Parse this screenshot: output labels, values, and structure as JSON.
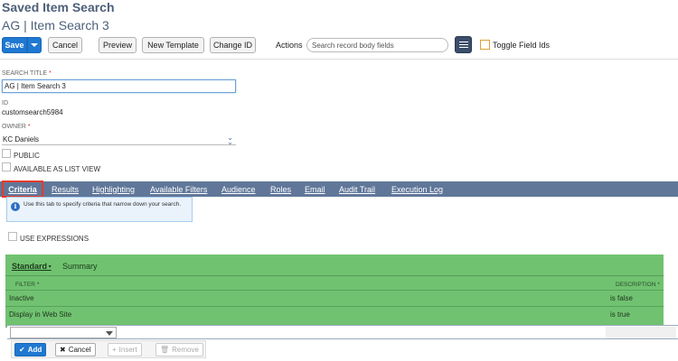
{
  "page": {
    "heading": "Saved Item Search",
    "record_title": "AG | Item Search 3"
  },
  "toolbar": {
    "save_label": "Save",
    "cancel_label": "Cancel",
    "preview_label": "Preview",
    "new_template_label": "New Template",
    "change_id_label": "Change ID",
    "actions_label": "Actions",
    "search_placeholder": "Search record body fields",
    "toggle_field_ids_label": "Toggle Field Ids",
    "primary_color": "#1f78d1",
    "toggle_color": "#e0a034"
  },
  "form": {
    "search_title_label": "SEARCH TITLE",
    "search_title_value": "AG | Item Search 3",
    "required_mark": "*",
    "id_label": "ID",
    "id_value": "customsearch5984",
    "owner_label": "OWNER",
    "owner_value": "KC Daniels",
    "public_label": "PUBLIC",
    "available_list_view_label": "AVAILABLE AS LIST VIEW"
  },
  "tabs": {
    "items": [
      {
        "label": "Criteria",
        "selected": true
      },
      {
        "label": "Results"
      },
      {
        "label": "Highlighting"
      },
      {
        "label": "Available Filters"
      },
      {
        "label": "Audience"
      },
      {
        "label": "Roles"
      },
      {
        "label": "Email"
      },
      {
        "label": "Audit Trail"
      },
      {
        "label": "Execution Log"
      }
    ],
    "bar_color": "#607799",
    "highlight_color": "#e53b2c"
  },
  "criteria": {
    "info_text": "Use this tab to specify criteria that narrow down your search.",
    "use_expressions_label": "USE EXPRESSIONS",
    "subtabs": {
      "standard_label": "Standard",
      "summary_label": "Summary"
    },
    "columns": {
      "filter": "FILTER",
      "description": "DESCRIPTION"
    },
    "rows": [
      {
        "filter": "Inactive",
        "description": "is false"
      },
      {
        "filter": "Display in Web Site",
        "description": "is true"
      }
    ],
    "highlight_color": "#5cba5c",
    "buttons": {
      "add": "Add",
      "cancel": "Cancel",
      "insert": "Insert",
      "remove": "Remove"
    }
  }
}
